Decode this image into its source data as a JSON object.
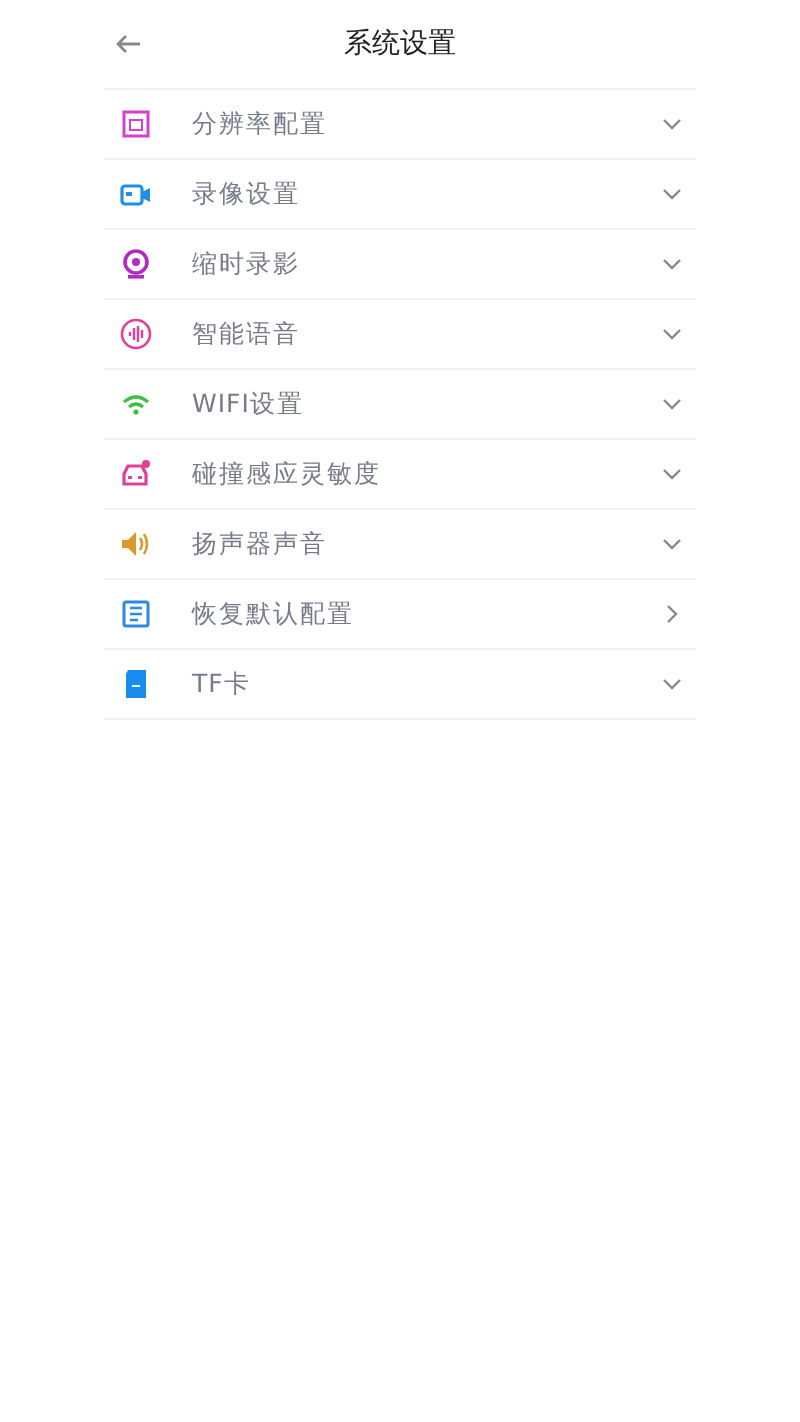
{
  "header": {
    "title": "系统设置"
  },
  "items": [
    {
      "label": "分辨率配置",
      "color": "#d63fc8",
      "kind": "dropdown"
    },
    {
      "label": "录像设置",
      "color": "#1f8fe8",
      "kind": "dropdown"
    },
    {
      "label": "缩时录影",
      "color": "#b02cc0",
      "kind": "dropdown"
    },
    {
      "label": "智能语音",
      "color": "#e0409a",
      "kind": "dropdown"
    },
    {
      "label": "WIFI设置",
      "color": "#3cc04a",
      "kind": "dropdown"
    },
    {
      "label": "碰撞感应灵敏度",
      "color": "#e0409a",
      "kind": "dropdown"
    },
    {
      "label": "扬声器声音",
      "color": "#d99a2e",
      "kind": "dropdown"
    },
    {
      "label": "恢复默认配置",
      "color": "#2a8be6",
      "kind": "link"
    },
    {
      "label": "TF卡",
      "color": "#1a8cf0",
      "kind": "dropdown"
    }
  ]
}
